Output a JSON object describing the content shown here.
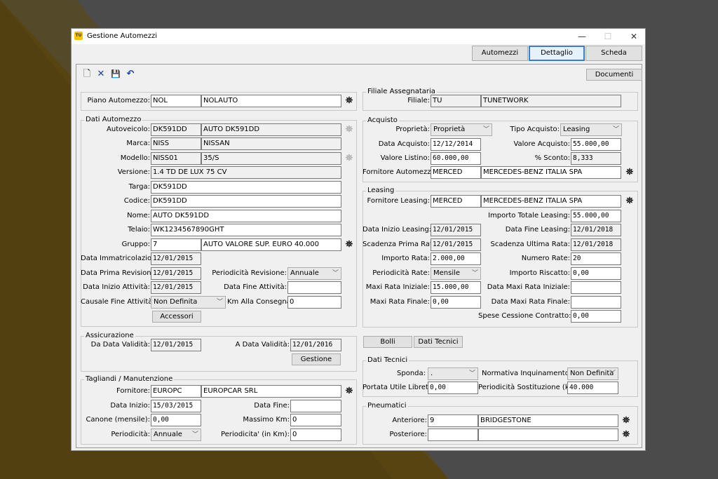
{
  "window": {
    "icon": "TU",
    "title": "Gestione Automezzi",
    "minimize": "—",
    "maximize": "☐",
    "close": "✕"
  },
  "tabs": [
    "Automezzi",
    "Dettaglio",
    "Scheda"
  ],
  "toolbar": {
    "new": "🗋",
    "delete": "✕",
    "save": "💾",
    "undo": "↶"
  },
  "documenti": "Documenti",
  "piano": {
    "label": "Piano Automezzo:",
    "code": "NOL",
    "desc": "NOLAUTO"
  },
  "dati": {
    "title": "Dati Automezzo",
    "autoveicolo_lbl": "Autoveicolo:",
    "autoveicolo_code": "DK591DD",
    "autoveicolo_desc": "AUTO DK591DD",
    "marca_lbl": "Marca:",
    "marca_code": "NISS",
    "marca_desc": "NISSAN",
    "modello_lbl": "Modello:",
    "modello_code": "NISS01",
    "modello_desc": "35/S",
    "versione_lbl": "Versione:",
    "versione": "1.4 TD DE LUX 75 CV",
    "targa_lbl": "Targa:",
    "targa": "DK591DD",
    "codice_lbl": "Codice:",
    "codice": "DK591DD",
    "nome_lbl": "Nome:",
    "nome": "AUTO DK591DD",
    "telaio_lbl": "Telaio:",
    "telaio": "WK1234567890GHT",
    "gruppo_lbl": "Gruppo:",
    "gruppo_code": "7",
    "gruppo_desc": "AUTO VALORE SUP. EURO 40.000",
    "immatr_lbl": "Data Immatricolazione:",
    "immatr": "12/01/2015",
    "prima_rev_lbl": "Data Prima Revisione:",
    "prima_rev": "12/01/2015",
    "period_rev_lbl": "Periodicità Revisione:",
    "period_rev": "Annuale",
    "inizio_att_lbl": "Data Inizio Attività:",
    "inizio_att": "12/01/2015",
    "fine_att_lbl": "Data Fine Attività:",
    "fine_att": "",
    "causale_lbl": "Causale Fine Attività:",
    "causale": "Non Definita",
    "km_lbl": "Km Alla Consegna:",
    "km": "0",
    "accessori": "Accessori"
  },
  "assic": {
    "title": "Assicurazione",
    "da_lbl": "Da Data Validità:",
    "da": "12/01/2015",
    "a_lbl": "A Data Validità:",
    "a": "12/01/2016",
    "gestione": "Gestione"
  },
  "tagl": {
    "title": "Tagliandi / Manutenzione",
    "forn_lbl": "Fornitore:",
    "forn_code": "EUROPC",
    "forn_desc": "EUROPCAR SRL",
    "inizio_lbl": "Data Inizio:",
    "inizio": "15/03/2015",
    "fine_lbl": "Data Fine:",
    "fine": "",
    "canone_lbl": "Canone (mensile):",
    "canone": "0,00",
    "maxkm_lbl": "Massimo Km:",
    "maxkm": "0",
    "period_lbl": "Periodicità:",
    "period": "Annuale",
    "periodkm_lbl": "Periodicita' (in Km):",
    "periodkm": "0"
  },
  "filiale": {
    "title": "Filiale Assegnataria",
    "lbl": "Filiale:",
    "code": "TU",
    "desc": "TUNETWORK"
  },
  "acq": {
    "title": "Acquisto",
    "prop_lbl": "Proprietà:",
    "prop": "Proprietà",
    "tipo_lbl": "Tipo Acquisto:",
    "tipo": "Leasing",
    "data_lbl": "Data Acquisto:",
    "data": "12/12/2014",
    "valore_lbl": "Valore Acquisto:",
    "valore": "55.000,00",
    "listino_lbl": "Valore Listino:",
    "listino": "60.000,00",
    "sconto_lbl": "% Sconto:",
    "sconto": "8,333",
    "forn_lbl": "Fornitore Automezzo:",
    "forn_code": "MERCED",
    "forn_desc": "MERCEDES-BENZ ITALIA SPA"
  },
  "leas": {
    "title": "Leasing",
    "forn_lbl": "Fornitore Leasing:",
    "forn_code": "MERCED",
    "forn_desc": "MERCEDES-BENZ ITALIA SPA",
    "totale_lbl": "Importo Totale Leasing:",
    "totale": "55.000,00",
    "inizio_lbl": "Data Inizio Leasing:",
    "inizio": "12/01/2015",
    "fine_lbl": "Data Fine Leasing:",
    "fine": "12/01/2018",
    "prima_lbl": "Scadenza Prima Rata:",
    "prima": "12/01/2015",
    "ultima_lbl": "Scadenza Ultima Rata:",
    "ultima": "12/01/2018",
    "rata_lbl": "Importo Rata:",
    "rata": "2.000,00",
    "num_lbl": "Numero Rate:",
    "num": "20",
    "period_lbl": "Periodicità Rate:",
    "period": "Mensile",
    "riscatto_lbl": "Importo Riscatto:",
    "riscatto": "0,00",
    "maxiin_lbl": "Maxi Rata Iniziale:",
    "maxiin": "15.000,00",
    "dmaxiin_lbl": "Data Maxi Rata Iniziale:",
    "dmaxiin": "",
    "maxifin_lbl": "Maxi Rata Finale:",
    "maxifin": "0,00",
    "dmaxifin_lbl": "Data Maxi Rata Finale:",
    "dmaxifin": "",
    "spese_lbl": "Spese Cessione Contratto:",
    "spese": "0,00"
  },
  "bolli": "Bolli",
  "dati_tecnici_btn": "Dati Tecnici",
  "tec": {
    "title": "Dati Tecnici",
    "sponda_lbl": "Sponda:",
    "sponda": ".",
    "norm_lbl": "Normativa Inquinamento:",
    "norm": "Non Definita",
    "portata_lbl": "Portata Utile Libretto:",
    "portata": "0,00",
    "perkm_lbl": "Periodicità Sostituzione (km):",
    "perkm": "40.000"
  },
  "pneu": {
    "title": "Pneumatici",
    "ant_lbl": "Anteriore:",
    "ant_code": "9",
    "ant_desc": "BRIDGESTONE",
    "post_lbl": "Posteriore:",
    "post_code": "",
    "post_desc": ""
  },
  "icons": {
    "binoculars": "⛯"
  }
}
